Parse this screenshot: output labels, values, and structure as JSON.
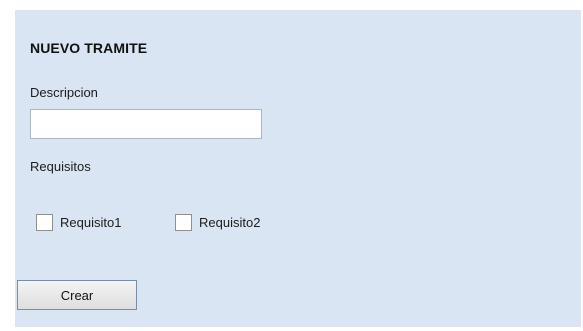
{
  "form": {
    "title": "NUEVO TRAMITE",
    "description_label": "Descripcion",
    "description_value": "",
    "description_placeholder": "",
    "requirements_label": "Requisitos",
    "checkboxes": [
      {
        "label": "Requisito1",
        "checked": false
      },
      {
        "label": "Requisito2",
        "checked": false
      }
    ],
    "create_button": "Crear"
  },
  "colors": {
    "panel_background": "#d9e5f2",
    "page_background": "#ffffff"
  }
}
